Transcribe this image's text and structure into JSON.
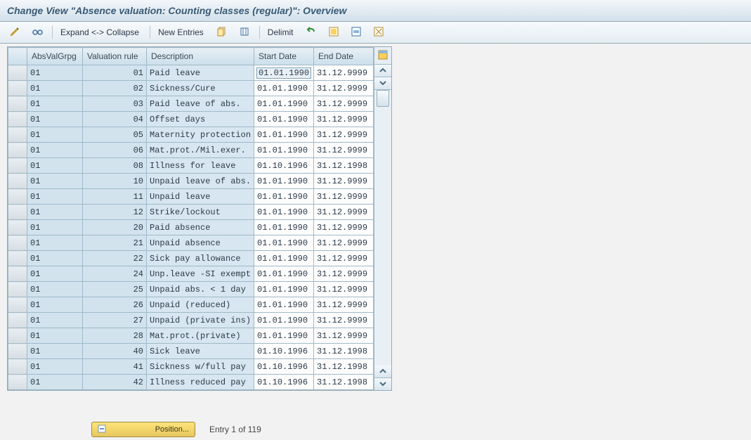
{
  "title": "Change View \"Absence valuation: Counting classes (regular)\": Overview",
  "toolbar": {
    "expand": "Expand <->",
    "collapse": "Collapse",
    "new_entries": "New Entries",
    "delimit": "Delimit"
  },
  "columns": {
    "sel": "",
    "grp": "AbsValGrpg",
    "rule": "Valuation rule",
    "desc": "Description",
    "start": "Start Date",
    "end": "End Date"
  },
  "rows": [
    {
      "grp": "01",
      "rule": "01",
      "desc": "Paid leave",
      "start": "01.01.1990",
      "end": "31.12.9999"
    },
    {
      "grp": "01",
      "rule": "02",
      "desc": "Sickness/Cure",
      "start": "01.01.1990",
      "end": "31.12.9999"
    },
    {
      "grp": "01",
      "rule": "03",
      "desc": "Paid leave of abs.",
      "start": "01.01.1990",
      "end": "31.12.9999"
    },
    {
      "grp": "01",
      "rule": "04",
      "desc": "Offset days",
      "start": "01.01.1990",
      "end": "31.12.9999"
    },
    {
      "grp": "01",
      "rule": "05",
      "desc": "Maternity protection",
      "start": "01.01.1990",
      "end": "31.12.9999"
    },
    {
      "grp": "01",
      "rule": "06",
      "desc": "Mat.prot./Mil.exer.",
      "start": "01.01.1990",
      "end": "31.12.9999"
    },
    {
      "grp": "01",
      "rule": "08",
      "desc": "Illness for leave",
      "start": "01.10.1996",
      "end": "31.12.1998"
    },
    {
      "grp": "01",
      "rule": "10",
      "desc": "Unpaid leave of abs.",
      "start": "01.01.1990",
      "end": "31.12.9999"
    },
    {
      "grp": "01",
      "rule": "11",
      "desc": "Unpaid leave",
      "start": "01.01.1990",
      "end": "31.12.9999"
    },
    {
      "grp": "01",
      "rule": "12",
      "desc": "Strike/lockout",
      "start": "01.01.1990",
      "end": "31.12.9999"
    },
    {
      "grp": "01",
      "rule": "20",
      "desc": "Paid absence",
      "start": "01.01.1990",
      "end": "31.12.9999"
    },
    {
      "grp": "01",
      "rule": "21",
      "desc": "Unpaid absence",
      "start": "01.01.1990",
      "end": "31.12.9999"
    },
    {
      "grp": "01",
      "rule": "22",
      "desc": "Sick pay allowance",
      "start": "01.01.1990",
      "end": "31.12.9999"
    },
    {
      "grp": "01",
      "rule": "24",
      "desc": "Unp.leave -SI exempt",
      "start": "01.01.1990",
      "end": "31.12.9999"
    },
    {
      "grp": "01",
      "rule": "25",
      "desc": "Unpaid abs. < 1 day",
      "start": "01.01.1990",
      "end": "31.12.9999"
    },
    {
      "grp": "01",
      "rule": "26",
      "desc": "Unpaid (reduced)",
      "start": "01.01.1990",
      "end": "31.12.9999"
    },
    {
      "grp": "01",
      "rule": "27",
      "desc": "Unpaid (private ins)",
      "start": "01.01.1990",
      "end": "31.12.9999"
    },
    {
      "grp": "01",
      "rule": "28",
      "desc": "Mat.prot.(private)",
      "start": "01.01.1990",
      "end": "31.12.9999"
    },
    {
      "grp": "01",
      "rule": "40",
      "desc": "Sick leave",
      "start": "01.10.1996",
      "end": "31.12.1998"
    },
    {
      "grp": "01",
      "rule": "41",
      "desc": "Sickness w/full pay",
      "start": "01.10.1996",
      "end": "31.12.1998"
    },
    {
      "grp": "01",
      "rule": "42",
      "desc": "Illness reduced pay",
      "start": "01.10.1996",
      "end": "31.12.1998"
    }
  ],
  "footer": {
    "position_btn": "Position...",
    "entry_status": "Entry 1 of 119"
  },
  "icons": {
    "toggle": "toggle-display-change-icon",
    "glasses": "other-view-icon",
    "copy": "copy-icon",
    "delete": "delete-icon",
    "undo": "undo-icon",
    "select_all": "select-all-icon",
    "select_block": "select-block-icon",
    "deselect": "deselect-all-icon",
    "config": "table-settings-icon",
    "pos": "position-icon"
  },
  "colors": {
    "header_blue": "#a8c8dd",
    "row_blue": "#d2e3ee"
  }
}
